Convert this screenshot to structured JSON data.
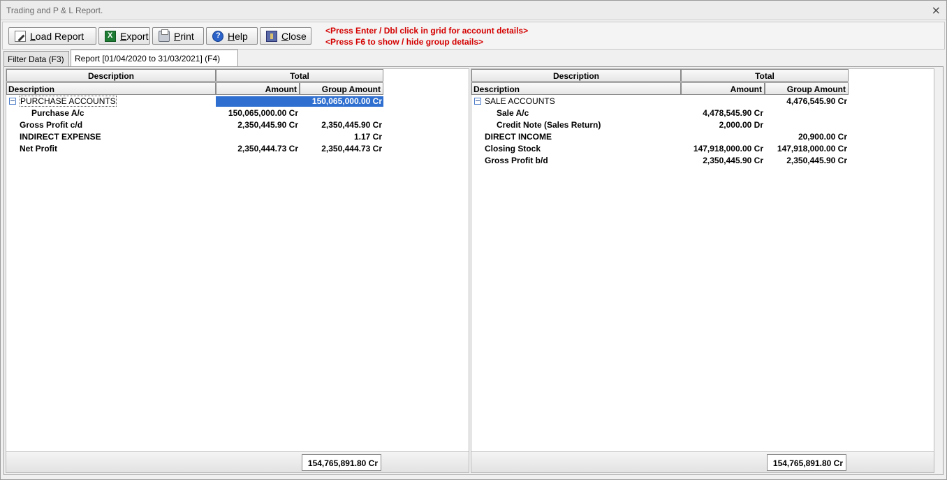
{
  "window": {
    "title": "Trading and P & L Report.",
    "close_glyph": "×"
  },
  "toolbar": {
    "load_label": "Load Report",
    "export_label": "Export",
    "print_label": "Print",
    "help_label": "Help",
    "close_label": "Close",
    "hint1": "<Press Enter / Dbl click in grid for account details>",
    "hint2": "<Press F6 to show / hide group details>",
    "hint_color": "#d40000"
  },
  "tabs": [
    {
      "label": "Filter Data (F3)",
      "active": false
    },
    {
      "label": "Report [01/04/2020 to 31/03/2021] (F4)",
      "active": true
    }
  ],
  "grid_headers": {
    "description": "Description",
    "total": "Total",
    "sub_description": "Description",
    "amount": "Amount",
    "group_amount": "Group Amount"
  },
  "left": {
    "rows": [
      {
        "desc": "PURCHASE ACCOUNTS",
        "amount": "",
        "group_amount": "150,065,000.00 Cr",
        "group": true,
        "selected": true
      },
      {
        "desc": "Purchase A/c",
        "amount": "150,065,000.00 Cr",
        "group_amount": "",
        "level": 1
      },
      {
        "desc": "Gross Profit c/d",
        "amount": "2,350,445.90 Cr",
        "group_amount": "2,350,445.90 Cr",
        "level": 0
      },
      {
        "desc": "INDIRECT EXPENSE",
        "amount": "",
        "group_amount": "1.17 Cr",
        "level": 0
      },
      {
        "desc": "Net Profit",
        "amount": "2,350,444.73 Cr",
        "group_amount": "2,350,444.73 Cr",
        "level": 0
      }
    ],
    "total": "154,765,891.80 Cr"
  },
  "right": {
    "rows": [
      {
        "desc": "SALE ACCOUNTS",
        "amount": "",
        "group_amount": "4,476,545.90 Cr",
        "group": true
      },
      {
        "desc": "Sale A/c",
        "amount": "4,478,545.90 Cr",
        "group_amount": "",
        "level": 1
      },
      {
        "desc": "Credit Note (Sales Return)",
        "amount": "2,000.00 Dr",
        "group_amount": "",
        "level": 1
      },
      {
        "desc": "DIRECT INCOME",
        "amount": "",
        "group_amount": "20,900.00 Cr",
        "level": 0
      },
      {
        "desc": "Closing Stock",
        "amount": "147,918,000.00 Cr",
        "group_amount": "147,918,000.00 Cr",
        "level": 0
      },
      {
        "desc": "Gross Profit b/d",
        "amount": "2,350,445.90 Cr",
        "group_amount": "2,350,445.90 Cr",
        "level": 0
      }
    ],
    "total": "154,765,891.80 Cr"
  },
  "colors": {
    "selection": "#2f6fcf",
    "expander_border": "#4a7cc9"
  },
  "icons": [
    "load-report-icon",
    "excel-export-icon",
    "printer-icon",
    "help-icon",
    "close-door-icon",
    "collapse-icon"
  ]
}
